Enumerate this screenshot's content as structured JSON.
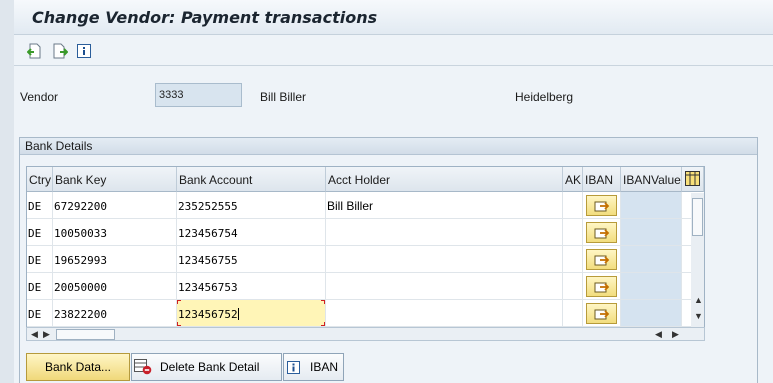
{
  "window": {
    "title": "Change Vendor: Payment transactions"
  },
  "toolbar": {
    "icons": [
      "previous-screen-icon",
      "next-screen-icon",
      "info-icon"
    ]
  },
  "vendor": {
    "label": "Vendor",
    "number": "3333",
    "name": "Bill Biller",
    "city": "Heidelberg"
  },
  "bank_details": {
    "group_title": "Bank Details",
    "columns": [
      "Ctry",
      "Bank Key",
      "Bank Account",
      "Acct Holder",
      "AK",
      "IBAN",
      "IBANValue"
    ],
    "rows": [
      {
        "ctry": "DE",
        "bank_key": "67292200",
        "bank_account": "235252555",
        "acct_holder": "Bill Biller",
        "ak": "",
        "ibanvalue": ""
      },
      {
        "ctry": "DE",
        "bank_key": "10050033",
        "bank_account": "123456754",
        "acct_holder": "",
        "ak": "",
        "ibanvalue": ""
      },
      {
        "ctry": "DE",
        "bank_key": "19652993",
        "bank_account": "123456755",
        "acct_holder": "",
        "ak": "",
        "ibanvalue": ""
      },
      {
        "ctry": "DE",
        "bank_key": "20050000",
        "bank_account": "123456753",
        "acct_holder": "",
        "ak": "",
        "ibanvalue": ""
      },
      {
        "ctry": "DE",
        "bank_key": "23822200",
        "bank_account": "123456752",
        "acct_holder": "",
        "ak": "",
        "ibanvalue": ""
      }
    ]
  },
  "buttons": {
    "bank_data": "Bank Data...",
    "delete_bank_detail": "Delete Bank Detail",
    "iban": "IBAN"
  },
  "colors": {
    "button_yellow": "#f4de86",
    "field_blue": "#d8e4ef",
    "background": "#eef3f8"
  }
}
